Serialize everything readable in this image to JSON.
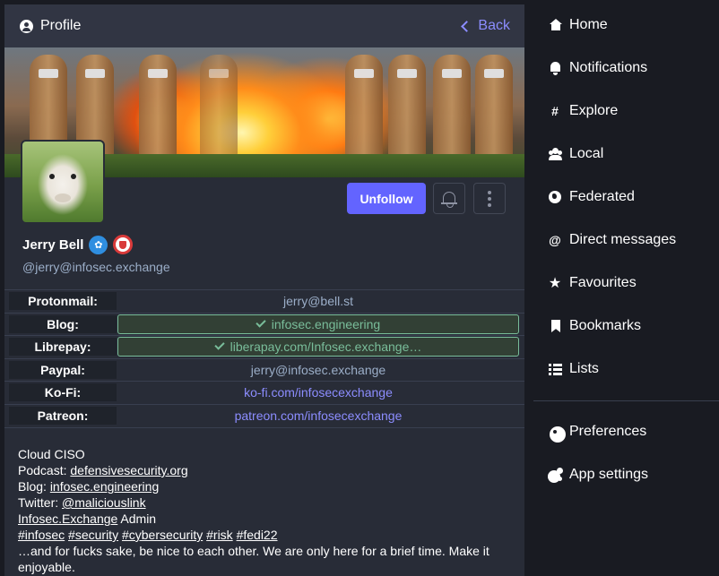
{
  "column": {
    "title": "Profile",
    "back_label": "Back"
  },
  "profile": {
    "display_name": "Jerry Bell",
    "account": "@jerry@infosec.exchange",
    "unfollow_label": "Unfollow"
  },
  "fields": [
    {
      "name": "Protonmail:",
      "value": "jerry@bell.st",
      "verified": false,
      "link": false
    },
    {
      "name": "Blog:",
      "value": "infosec.engineering",
      "verified": true,
      "link": true
    },
    {
      "name": "Librepay:",
      "value": "liberapay.com/Infosec.exchange…",
      "verified": true,
      "link": true
    },
    {
      "name": "Paypal:",
      "value": "jerry@infosec.exchange",
      "verified": false,
      "link": false
    },
    {
      "name": "Ko-Fi:",
      "value": "ko-fi.com/infosecexchange",
      "verified": false,
      "link": true
    },
    {
      "name": "Patreon:",
      "value": "patreon.com/infosecexchange",
      "verified": false,
      "link": true
    }
  ],
  "bio": {
    "line1": "Cloud CISO",
    "podcast_label": "Podcast: ",
    "podcast_link": "defensivesecurity.org",
    "blog_label": "Blog: ",
    "blog_link": "infosec.engineering",
    "twitter_label": "Twitter: ",
    "twitter_link": "@maliciouslink",
    "admin_link": "Infosec.Exchange",
    "admin_text": " Admin",
    "hashtags": [
      "#infosec",
      "#security",
      "#cybersecurity",
      "#risk",
      "#fedi22"
    ],
    "closing": "…and for fucks sake, be nice to each other. We are only here for a brief time. Make it enjoyable."
  },
  "nav": {
    "items": [
      {
        "label": "Home",
        "icon": "home-icon"
      },
      {
        "label": "Notifications",
        "icon": "bell-icon"
      },
      {
        "label": "Explore",
        "icon": "hashtag-icon"
      },
      {
        "label": "Local",
        "icon": "users-icon"
      },
      {
        "label": "Federated",
        "icon": "globe-icon"
      },
      {
        "label": "Direct messages",
        "icon": "at-icon"
      },
      {
        "label": "Favourites",
        "icon": "star-icon"
      },
      {
        "label": "Bookmarks",
        "icon": "bookmark-icon"
      },
      {
        "label": "Lists",
        "icon": "list-icon"
      }
    ],
    "settings": [
      {
        "label": "Preferences",
        "icon": "gear-icon"
      },
      {
        "label": "App settings",
        "icon": "gears-icon"
      }
    ]
  },
  "colors": {
    "accent": "#6364ff",
    "link": "#8c8dff",
    "verified": "#79bd9a",
    "background": "#191b22",
    "panel": "#282c37"
  }
}
